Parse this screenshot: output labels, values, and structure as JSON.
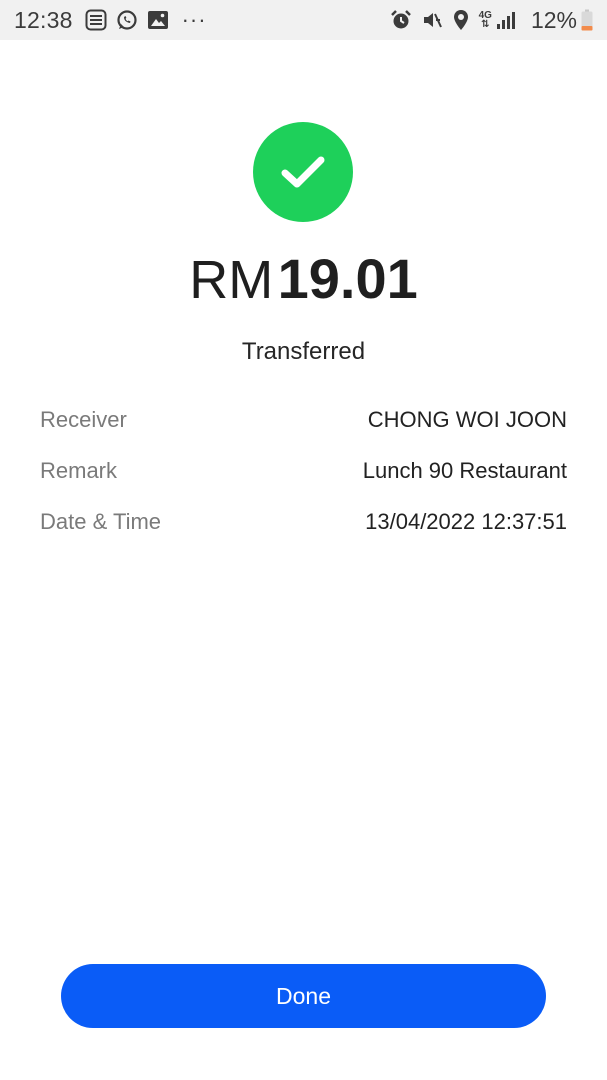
{
  "status_bar": {
    "time": "12:38",
    "network": "4G",
    "battery": "12%",
    "more": "···",
    "left_icons": [
      "touch-n-go-icon",
      "whatsapp-icon",
      "gallery-icon"
    ],
    "right_icons": [
      "alarm-icon",
      "mute-icon",
      "location-icon",
      "signal-icon",
      "battery-icon"
    ]
  },
  "transaction": {
    "currency": "RM",
    "amount": "19.01",
    "status": "Transferred",
    "details": [
      {
        "label": "Receiver",
        "value": "CHONG WOI JOON"
      },
      {
        "label": "Remark",
        "value": "Lunch 90 Restaurant"
      },
      {
        "label": "Date & Time",
        "value": "13/04/2022 12:37:51"
      }
    ]
  },
  "actions": {
    "done_label": "Done"
  },
  "colors": {
    "success": "#1ed05a",
    "primary": "#0a5cf7",
    "battery_low": "#f28b4b"
  }
}
